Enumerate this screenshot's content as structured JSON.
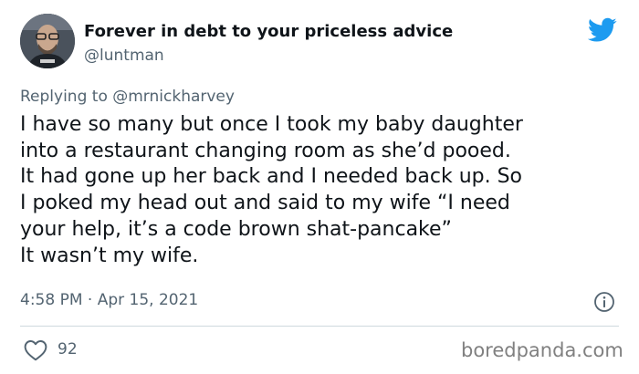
{
  "author": {
    "display_name": "Forever in debt to your priceless advice",
    "handle": "@luntman",
    "avatar_icon": "profile-photo"
  },
  "brand": {
    "icon": "twitter-bird-icon",
    "color": "#1d9bf0"
  },
  "reply": {
    "prefix": "Replying to",
    "handle": "@mrnickharvey"
  },
  "tweet": {
    "lines": [
      "I have so many but once I took my baby daughter",
      "into a restaurant changing room as she’d pooed.",
      "It had gone up her back and I needed back up.  So",
      "I poked my head out and said to my wife “I need",
      "your help, it’s a code brown shat-pancake”",
      "It wasn’t my wife."
    ],
    "timestamp": "4:58 PM · Apr 15, 2021"
  },
  "engagement": {
    "likes": "92"
  },
  "watermark": "boredpanda.com"
}
